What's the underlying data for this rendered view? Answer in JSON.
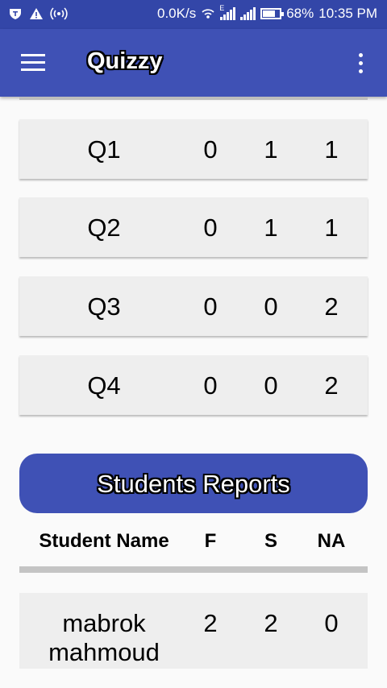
{
  "status_bar": {
    "speed": "0.0K/s",
    "network_type": "E",
    "battery": "68%",
    "time": "10:35 PM"
  },
  "toolbar": {
    "title": "Quizzy"
  },
  "questions": [
    {
      "label": "Q1",
      "f": "0",
      "s": "1",
      "na": "1"
    },
    {
      "label": "Q2",
      "f": "0",
      "s": "1",
      "na": "1"
    },
    {
      "label": "Q3",
      "f": "0",
      "s": "0",
      "na": "2"
    },
    {
      "label": "Q4",
      "f": "0",
      "s": "0",
      "na": "2"
    }
  ],
  "reports_button": "Students Reports",
  "table_header": {
    "name": "Student Name",
    "f": "F",
    "s": "S",
    "na": "NA"
  },
  "students": [
    {
      "name_line1": "mabrok",
      "name_line2": "mahmoud",
      "f": "2",
      "s": "2",
      "na": "0"
    }
  ],
  "colors": {
    "primary": "#3f51b5",
    "primary_dark": "#3346a8",
    "row_bg": "#eeeeee"
  }
}
